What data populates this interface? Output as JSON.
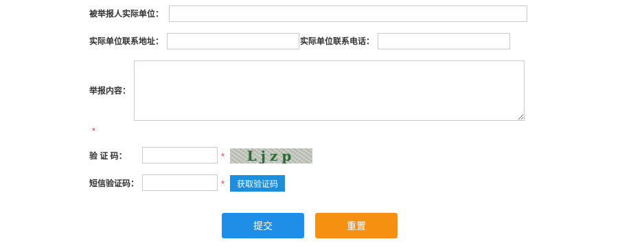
{
  "form": {
    "unit_label": "被举报人实际单位：",
    "unit_value": "",
    "address_label": "实际单位联系地址：",
    "address_value": "",
    "phone_label": "实际单位联系电话：",
    "phone_value": "",
    "content_label": "举报内容：",
    "content_value": "",
    "content_required": "*",
    "captcha_label": "验 证 码：",
    "captcha_value": "",
    "captcha_required": "*",
    "captcha_text": "Ljzp",
    "sms_label": "短信验证码：",
    "sms_value": "",
    "sms_required": "*",
    "sms_button": "获取验证码"
  },
  "actions": {
    "submit": "提交",
    "reset": "重置"
  },
  "colors": {
    "submit_bg": "#1f8ee6",
    "reset_bg": "#f59011",
    "sms_bg": "#1a8fe0",
    "required": "#e4393c"
  }
}
